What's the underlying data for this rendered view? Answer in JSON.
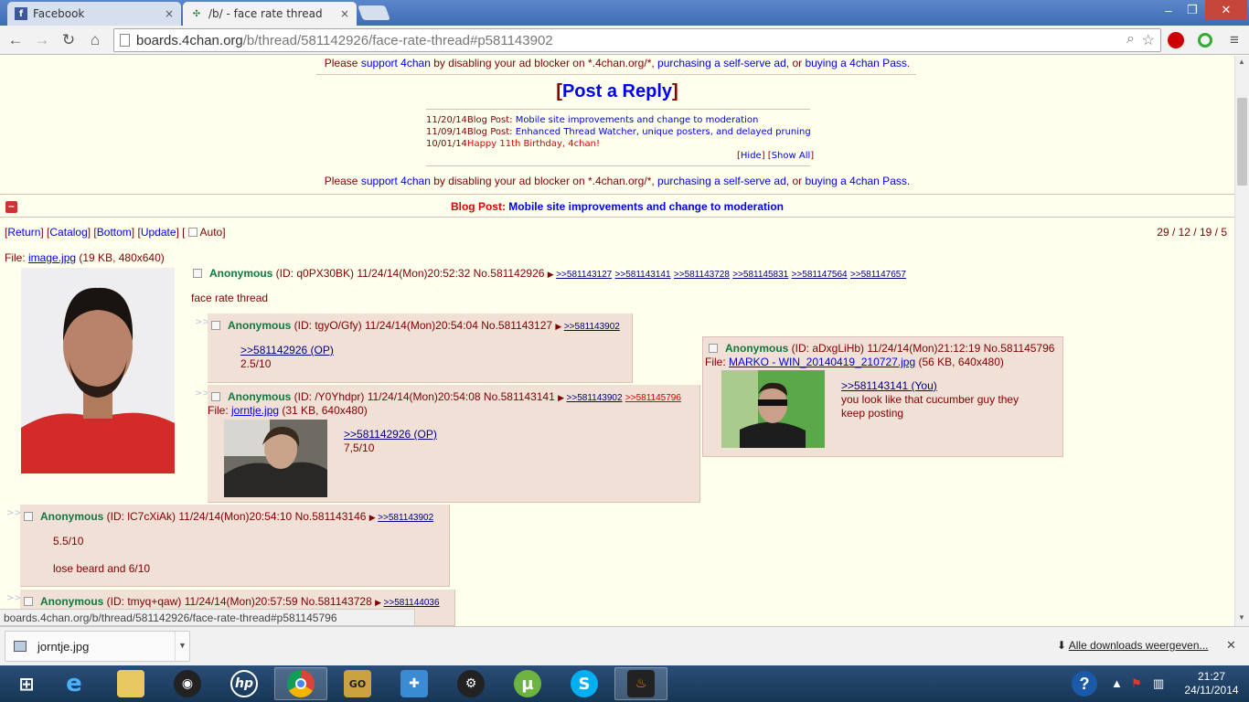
{
  "tabs": [
    {
      "title": "Facebook",
      "close": "×"
    },
    {
      "title": "/b/ - face rate thread",
      "close": "×"
    }
  ],
  "address": {
    "host": "boards.4chan.org",
    "path": "/b/thread/581142926/face-rate-thread#p581143902"
  },
  "ad_notice": {
    "pre": "Please ",
    "link1": "support 4chan",
    "mid1": " by disabling your ad blocker on *.4chan.org/*, ",
    "link2": "purchasing a self-serve ad",
    "mid2": ", or ",
    "link3": "buying a 4chan Pass",
    "post": "."
  },
  "post_a_reply": "Post a Reply",
  "news": [
    {
      "date": "11/20/14",
      "label": "Blog Post: ",
      "text": "Mobile site improvements and change to moderation"
    },
    {
      "date": "11/09/14",
      "label": "Blog Post: ",
      "text": "Enhanced Thread Watcher, unique posters, and delayed pruning"
    },
    {
      "date": "10/01/14",
      "label": "",
      "text": "Happy 11th Birthday, 4chan!"
    }
  ],
  "news_controls": {
    "hide": "Hide",
    "show_all": "Show All"
  },
  "blog_bar": {
    "label": "Blog Post: ",
    "text": "Mobile site improvements and change to moderation"
  },
  "nav": {
    "return": "Return",
    "catalog": "Catalog",
    "bottom": "Bottom",
    "update": "Update",
    "auto": "Auto"
  },
  "stats": "29 / 12 / 19 / 5",
  "op": {
    "file_label": "File: ",
    "file_name": "image.jpg",
    "file_meta": " (19 KB, 480x640)",
    "name": "Anonymous",
    "id": " (ID: q0PX30BK) ",
    "datetime": "11/24/14(Mon)20:52:32",
    "no": " No.581142926",
    "backlinks": [
      ">>581143127",
      ">>581143141",
      ">>581143728",
      ">>581145831",
      ">>581147564",
      ">>581147657"
    ],
    "comment": "face rate thread"
  },
  "replies": [
    {
      "name": "Anonymous",
      "id": " (ID: tgyO/Gfy) ",
      "datetime": "11/24/14(Mon)20:54:04",
      "no": " No.581143127",
      "backlinks": [
        ">>581143902"
      ],
      "quote": ">>581142926 (OP)",
      "text": "2.5/10"
    },
    {
      "name": "Anonymous",
      "id": " (ID: /Y0Yhdpr) ",
      "datetime": "11/24/14(Mon)20:54:08",
      "no": " No.581143141",
      "backlinks": [
        ">>581143902",
        ">>581145796"
      ],
      "file_label": "File: ",
      "file_name": "jorntje.jpg",
      "file_meta": " (31 KB, 640x480)",
      "quote": ">>581142926 (OP)",
      "text": "7,5/10"
    },
    {
      "name": "Anonymous",
      "id": " (ID: aDxgLiHb) ",
      "datetime": "11/24/14(Mon)21:12:19",
      "no": " No.581145796",
      "file_label": "File: ",
      "file_name": "MARKO - WIN_20140419_210727.jpg",
      "file_meta": " (56 KB, 640x480)",
      "quote": ">>581143141 (You)",
      "text1": "you look like that cucumber guy they",
      "text2": "keep posting"
    },
    {
      "name": "Anonymous",
      "id": " (ID: lC7cXiAk) ",
      "datetime": "11/24/14(Mon)20:54:10",
      "no": " No.581143146",
      "backlinks": [
        ">>581143902"
      ],
      "text1": "5.5/10",
      "text2": "lose beard and 6/10"
    },
    {
      "name": "Anonymous",
      "id": " (ID: tmyq+qaw) ",
      "datetime": "11/24/14(Mon)20:57:59",
      "no": " No.581143728",
      "backlinks": [
        ">>581144036"
      ]
    }
  ],
  "status_url": "boards.4chan.org/b/thread/581142926/face-rate-thread#p581145796",
  "download": {
    "file": "jorntje.jpg",
    "show_all": "Alle downloads weergeven..."
  },
  "clock": {
    "time": "21:27",
    "date": "24/11/2014"
  },
  "colors": {
    "name_green": "#117743",
    "reply_bg": "#f0e0d6",
    "page_bg": "#ffffee",
    "text_maroon": "#800000"
  }
}
